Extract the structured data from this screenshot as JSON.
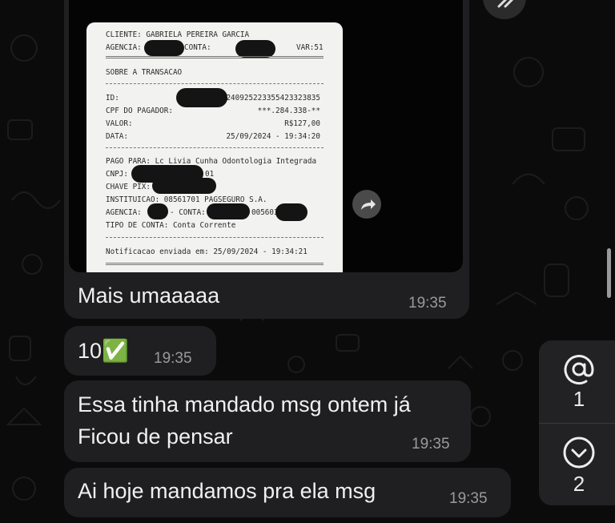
{
  "receipt": {
    "cliente": "CLIENTE: GABRIELA PEREIRA GARCIA",
    "agencia_label": "AGENCIA:",
    "conta_label": "CONTA:",
    "var": "VAR:51",
    "section_title": "SOBRE A TRANSACAO",
    "id_label": "ID:",
    "id_value": "240925223355423323835",
    "cpf_label": "CPF DO PAGADOR:",
    "cpf_value": "***.284.338-**",
    "valor_label": "VALOR:",
    "valor_value": "R$127,00",
    "data_label": "DATA:",
    "data_value": "25/09/2024 - 19:34:20",
    "pago_para": "PAGO PARA: Lc Livia Cunha Odontologia Integrada",
    "cnpj_label": "CNPJ:",
    "cnpj_suffix": "01",
    "chave_pix_label": "CHAVE PIX:",
    "instituicao": "INSTITUICAO: 08561701 PAGSEGURO S.A.",
    "agencia2_label": "AGENCIA:",
    "conta2_label": "- CONTA:",
    "conta2_partial": "005603",
    "tipo_conta": "TIPO DE CONTA: Conta Corrente",
    "notificacao": "Notificacao enviada em: 25/09/2024 - 19:34:21"
  },
  "messages": [
    {
      "text": "Mais umaaaaa",
      "time": "19:35"
    },
    {
      "text": "10✅",
      "time": "19:35"
    },
    {
      "line1": "Essa tinha mandado msg ontem já",
      "line2": "Ficou de pensar",
      "time": "19:35"
    },
    {
      "text": "Ai hoje mandamos pra ela msg",
      "time": "19:35"
    }
  ],
  "side_panel": {
    "mentions_count": "1",
    "unread_count": "2"
  },
  "colors": {
    "bubble": "#1f1f21",
    "background": "#0b0b0b",
    "checkmark": "#2db52d"
  }
}
